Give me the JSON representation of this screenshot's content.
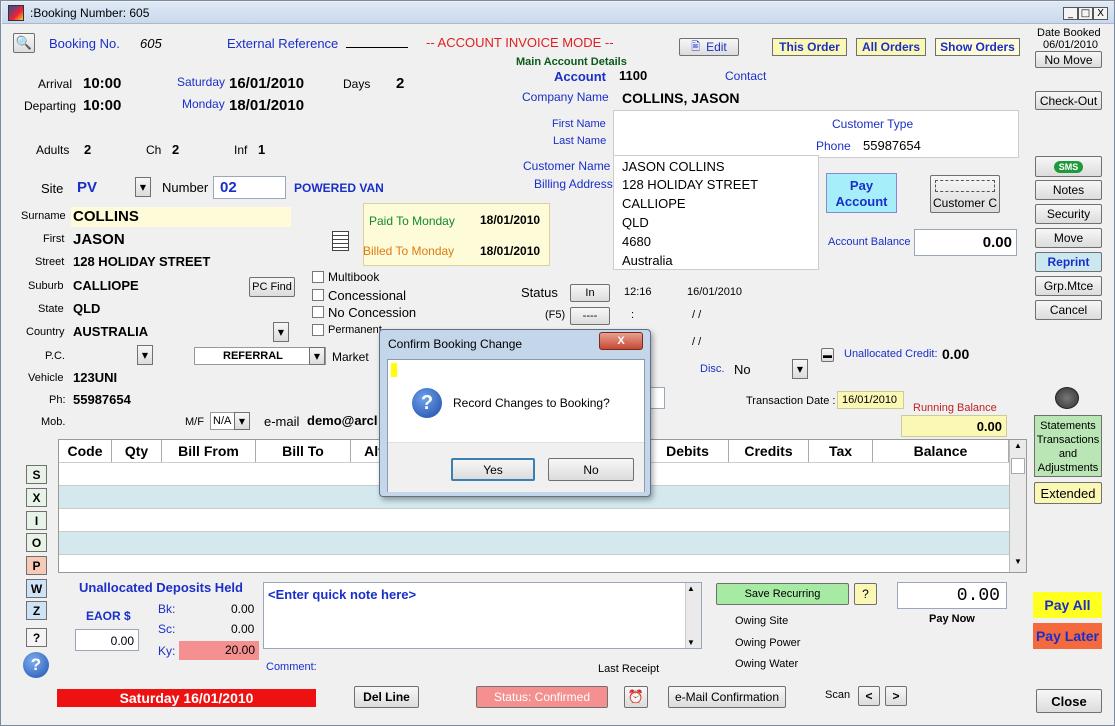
{
  "window": {
    "title": ":Booking Number: 605",
    "btn_min": "_",
    "btn_max": "□",
    "btn_close": "X"
  },
  "header": {
    "booking_no_label": "Booking No.",
    "booking_no": "605",
    "ext_ref_label": "External Reference",
    "mode": "-- ACCOUNT INVOICE MODE --",
    "edit": "Edit",
    "this_order": "This Order",
    "all_orders": "All Orders",
    "show_orders": "Show Orders",
    "date_booked_label": "Date Booked",
    "date_booked": "06/01/2010",
    "no_move": "No Move"
  },
  "stay": {
    "arrival_label": "Arrival",
    "arrival_time": "10:00",
    "arrival_day": "Saturday",
    "arrival_date": "16/01/2010",
    "departing_label": "Departing",
    "departing_time": "10:00",
    "departing_day": "Monday",
    "departing_date": "18/01/2010",
    "days_label": "Days",
    "days": "2",
    "adults_label": "Adults",
    "adults": "2",
    "ch_label": "Ch",
    "ch": "2",
    "inf_label": "Inf",
    "inf": "1"
  },
  "site": {
    "site_label": "Site",
    "site": "PV",
    "number_label": "Number",
    "number": "02",
    "site_type": "POWERED VAN"
  },
  "guest": {
    "surname_label": "Surname",
    "surname": "COLLINS",
    "first_label": "First",
    "first": "JASON",
    "street_label": "Street",
    "street": "128 HOLIDAY STREET",
    "suburb_label": "Suburb",
    "suburb": "CALLIOPE",
    "pc_find": "PC Find",
    "state_label": "State",
    "state": "QLD",
    "country_label": "Country",
    "country": "AUSTRALIA",
    "pc_label": "P.C.",
    "referral": "REFERRAL",
    "market_label": "Market",
    "vehicle_label": "Vehicle",
    "vehicle": "123UNI",
    "ph_label": "Ph:",
    "ph": "55987654",
    "mob_label": "Mob.",
    "mf_label": "M/F",
    "mf": "N/A",
    "email_label": "e-mail",
    "email": "demo@arcl"
  },
  "paid": {
    "paid_label": "Paid To Monday",
    "paid_date": "18/01/2010",
    "billed_label": "Billed To Monday",
    "billed_date": "18/01/2010"
  },
  "checks": {
    "multibook": "Multibook",
    "concessional": "Concessional",
    "no_concession": "No Concession",
    "permanent": "Permanent"
  },
  "account": {
    "main_label": "Main Account Details",
    "account_label": "Account",
    "account": "1100",
    "contact_label": "Contact",
    "company_label": "Company Name",
    "company": "COLLINS, JASON",
    "first_name_label": "First Name",
    "last_name_label": "Last Name",
    "customer_type_label": "Customer Type",
    "phone_label": "Phone",
    "phone": "55987654",
    "customer_name_label": "Customer Name",
    "billing_label": "Billing Address",
    "billing": [
      "JASON COLLINS",
      "128 HOLIDAY STREET",
      "CALLIOPE",
      "QLD",
      "4680",
      "Australia"
    ],
    "pay_account": "Pay Account",
    "customer_btn": "Customer C",
    "balance_label": "Account Balance",
    "balance": "0.00"
  },
  "status": {
    "status_label": "Status",
    "status_btn": "In",
    "time": "12:16",
    "date": "16/01/2010",
    "f5_label": "(F5)",
    "f5_btn": "----",
    "colon": ":",
    "slashes1": "/ /",
    "slashes2": "/ /",
    "disc_label": "Disc.",
    "disc": "No",
    "unalloc_label": "Unallocated Credit:",
    "unalloc": "0.00",
    "trans_label": "Transaction Date :",
    "trans_date": "16/01/2010",
    "running_label": "Running Balance",
    "running": "0.00"
  },
  "right_buttons": {
    "checkout": "Check-Out",
    "sms": "SMS",
    "notes": "Notes",
    "security": "Security",
    "move": "Move",
    "reprint": "Reprint",
    "grp": "Grp.Mtce",
    "cancel": "Cancel",
    "statements": "Statements Transactions and Adjustments",
    "extended": "Extended",
    "pay_all": "Pay All",
    "pay_later": "Pay Later",
    "close": "Close"
  },
  "grid": {
    "headers": [
      "Code",
      "Qty",
      "Bill From",
      "Bill To",
      "Alt R",
      "",
      "Debits",
      "Credits",
      "Tax",
      "Balance"
    ]
  },
  "side_letters": [
    "S",
    "X",
    "I",
    "O",
    "P",
    "W",
    "Z",
    "?"
  ],
  "bottom": {
    "unalloc_dep": "Unallocated Deposits Held",
    "eaor_label": "EAOR $",
    "eaor": "0.00",
    "bk_label": "Bk:",
    "bk": "0.00",
    "sc_label": "Sc:",
    "sc": "0.00",
    "ky_label": "Ky:",
    "ky": "20.00",
    "quick_note": "<Enter quick note here>",
    "comment_label": "Comment:",
    "save_recurring": "Save Recurring",
    "q": "?",
    "pay_now_amount": "0.00",
    "pay_now": "Pay Now",
    "owing_site": "Owing Site",
    "owing_power": "Owing Power",
    "owing_water": "Owing Water",
    "last_receipt": "Last Receipt",
    "date_banner": "Saturday 16/01/2010",
    "del_line": "Del Line",
    "status_confirmed": "Status: Confirmed",
    "email_conf": "e-Mail Confirmation",
    "scan_label": "Scan",
    "prev": "<",
    "next": ">"
  },
  "dialog": {
    "title": "Confirm Booking Change",
    "message": "Record Changes to Booking?",
    "yes": "Yes",
    "no": "No",
    "close": "X",
    "question": "?"
  }
}
